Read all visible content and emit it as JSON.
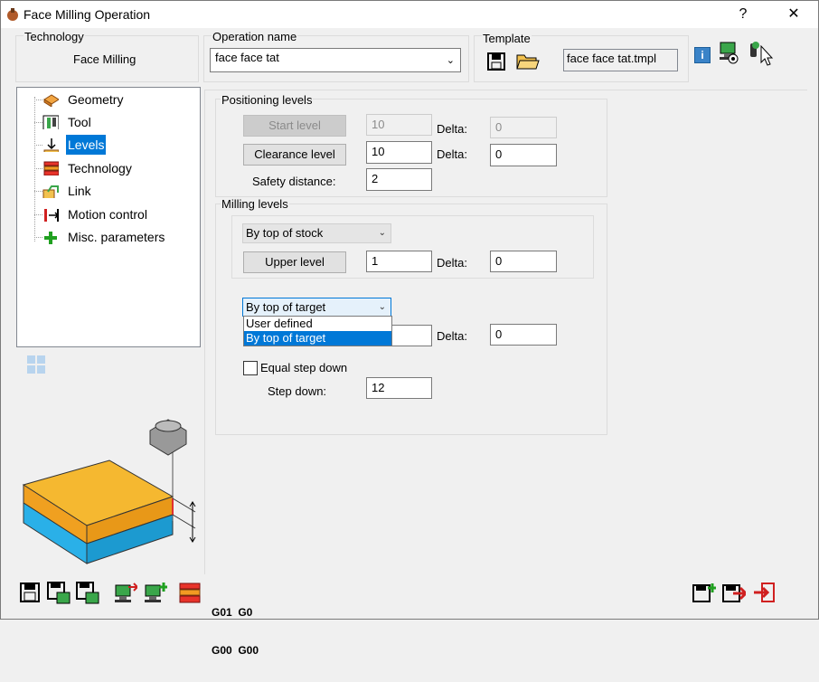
{
  "window": {
    "title": "Face Milling Operation",
    "help_label": "?",
    "close_label": "✕"
  },
  "technology": {
    "group_label": "Technology",
    "value": "Face Milling"
  },
  "operation_name": {
    "group_label": "Operation name",
    "value": "face face tat"
  },
  "template": {
    "group_label": "Template",
    "file": "face face tat.tmpl"
  },
  "tree": {
    "items": [
      {
        "label": "Geometry",
        "icon": "geometry-icon"
      },
      {
        "label": "Tool",
        "icon": "tool-icon"
      },
      {
        "label": "Levels",
        "icon": "levels-icon",
        "selected": true
      },
      {
        "label": "Technology",
        "icon": "technology-icon"
      },
      {
        "label": "Link",
        "icon": "link-icon"
      },
      {
        "label": "Motion control",
        "icon": "motion-control-icon"
      },
      {
        "label": "Misc. parameters",
        "icon": "plus-icon"
      }
    ]
  },
  "positioning": {
    "group_label": "Positioning levels",
    "start_level_button": "Start level",
    "start_level_value": "10",
    "start_delta_label": "Delta:",
    "start_delta_value": "0",
    "clearance_button": "Clearance level",
    "clearance_value": "10",
    "clearance_delta_label": "Delta:",
    "clearance_delta_value": "0",
    "safety_label": "Safety distance:",
    "safety_value": "2"
  },
  "milling": {
    "group_label": "Milling levels",
    "upper_combo": "By top of stock",
    "upper_button": "Upper level",
    "upper_value": "1",
    "upper_delta_label": "Delta:",
    "upper_delta_value": "0",
    "lower_combo": "By top of target",
    "lower_options": [
      "User defined",
      "By top of target"
    ],
    "lower_delta_label": "Delta:",
    "lower_delta_value": "0",
    "equal_step_label": "Equal step down",
    "step_down_label": "Step down:",
    "step_down_value": "12"
  },
  "bottom_toolbar": {
    "gcode_top": "G01  G0",
    "gcode_bottom": "G00  G00"
  },
  "colors": {
    "selection": "#0078d7",
    "stock_top": "#f5b830",
    "stock_side": "#29a8e0"
  }
}
